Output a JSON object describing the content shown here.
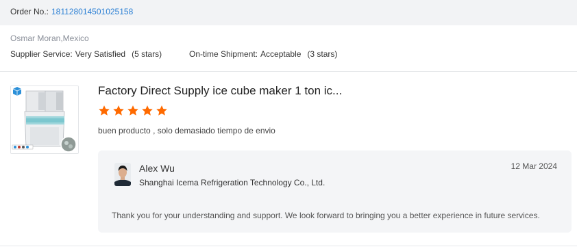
{
  "order": {
    "label": "Order No.:",
    "number": "181128014501025158"
  },
  "review": {
    "buyer": "Osmar Moran,Mexico",
    "ratings": [
      {
        "label": "Supplier Service:",
        "value": "Very Satisfied",
        "stars_text": "(5 stars)"
      },
      {
        "label": "On-time Shipment:",
        "value": "Acceptable",
        "stars_text": "(3 stars)"
      }
    ]
  },
  "product": {
    "title": "Factory Direct Supply ice cube maker 1 ton ic...",
    "rating_stars": 5,
    "star_color": "#ff6a00",
    "comment": "buen producto , solo demasiado tiempo de envio",
    "image_icon": "ice-machine-thumbnail"
  },
  "reply": {
    "name": "Alex Wu",
    "company": "Shanghai Icema Refrigeration Technology Co., Ltd.",
    "date": "12 Mar 2024",
    "text": "Thank you for your understanding and support. We look forward to bringing you a better experience in future services."
  },
  "colors": {
    "link": "#2a7fd4",
    "order_bar_bg": "#f2f3f5",
    "reply_bg": "#f4f5f7"
  }
}
